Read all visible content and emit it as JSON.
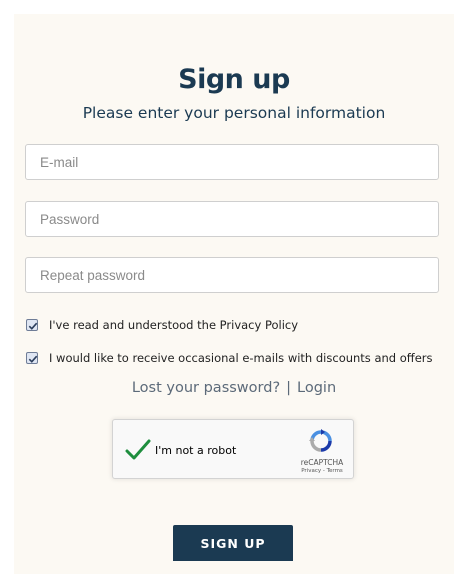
{
  "form": {
    "title": "Sign up",
    "subtitle": "Please enter your personal information",
    "email_placeholder": "E-mail",
    "password_placeholder": "Password",
    "repeat_password_placeholder": "Repeat password",
    "privacy_checkbox_label": "I've read and understood the Privacy Policy",
    "privacy_checked": true,
    "newsletter_checkbox_label": "I would like to receive occasional e-mails with discounts and offers",
    "newsletter_checked": true,
    "lost_password_link": "Lost your password?",
    "link_separator": "|",
    "login_link": "Login",
    "submit_label": "SIGN UP"
  },
  "recaptcha": {
    "label": "I'm not a robot",
    "checked": true,
    "brand": "reCAPTCHA",
    "terms": "Privacy - Terms"
  },
  "colors": {
    "primary": "#1b3a52",
    "panel_bg": "#fcf9f3",
    "link": "#5c6a79",
    "recaptcha_check": "#1e8e3e"
  },
  "icons": {
    "recaptcha_check": "check-icon",
    "recaptcha_logo": "recaptcha-logo-icon",
    "checkbox_mark": "checkbox-checked-icon"
  }
}
